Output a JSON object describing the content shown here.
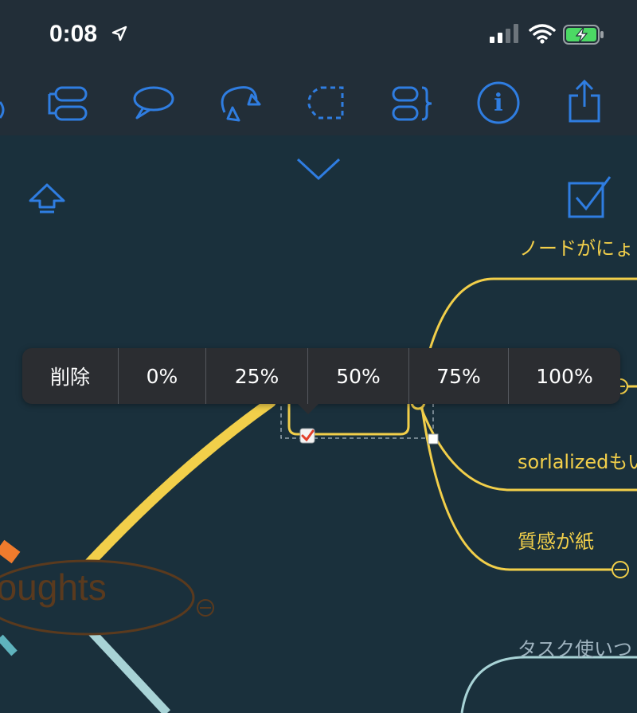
{
  "status_bar": {
    "time": "0:08",
    "location_icon": "location-arrow-icon",
    "signal_icon": "cellular-signal-icon",
    "wifi_icon": "wifi-icon",
    "battery_icon": "battery-charging-icon"
  },
  "toolbar": {
    "icons": [
      "partial-left-icon",
      "boundary-node-icon",
      "callout-icon",
      "relationship-icon",
      "dashed-boundary-icon",
      "summary-brace-icon",
      "info-icon",
      "share-icon"
    ]
  },
  "canvas_controls": {
    "collapse_icon": "chevron-down-icon",
    "up_icon": "arrow-up-icon",
    "task_icon": "checkbox-checked-icon"
  },
  "nodes": {
    "node1": "ノードがにょ",
    "node2": "sorlalizedもい",
    "node3": "質感が紙",
    "node4": "タスク使いつ",
    "central": "noughts"
  },
  "progress_menu": {
    "options": [
      "削除",
      "0%",
      "25%",
      "50%",
      "75%",
      "100%"
    ]
  },
  "colors": {
    "background": "#1a303c",
    "toolbar": "#222e38",
    "accent_blue": "#2f7de1",
    "branch_yellow": "#f2cf4a",
    "branch_light": "#a8d3d6",
    "central_border": "#5a3a1e",
    "popup_bg": "#2b2d31"
  }
}
